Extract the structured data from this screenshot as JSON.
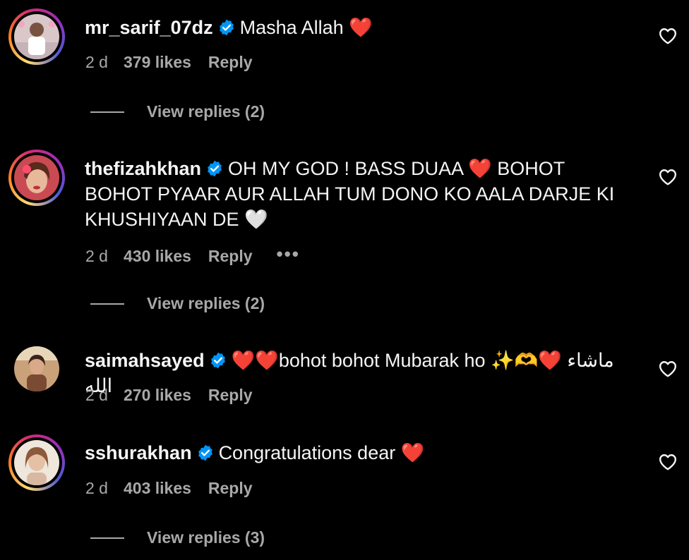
{
  "comments": [
    {
      "username": "mr_sarif_07dz",
      "text": "Masha Allah ❤️",
      "time": "2 d",
      "likes": "379 likes",
      "reply": "Reply",
      "view_replies": "View replies (2)"
    },
    {
      "username": "thefizahkhan",
      "text": "OH MY GOD ! BASS DUAA ❤️ BOHOT BOHOT PYAAR AUR ALLAH TUM DONO KO AALA DARJE KI KHUSHIYAAN DE 🤍",
      "time": "2 d",
      "likes": "430 likes",
      "reply": "Reply",
      "more": "•••",
      "view_replies": "View replies (2)"
    },
    {
      "username": "saimahsayed",
      "text": "❤️❤️bohot bohot Mubarak ho ✨🫶❤️ ماشاء الله",
      "time": "2 d",
      "likes": "270 likes",
      "reply": "Reply"
    },
    {
      "username": "sshurakhan",
      "text": "Congratulations dear ❤️",
      "time": "2 d",
      "likes": "403 likes",
      "reply": "Reply",
      "view_replies": "View replies (3)"
    }
  ],
  "icons": {
    "verified": "verified-badge-icon",
    "like": "heart-outline-icon"
  },
  "colors": {
    "background": "#000000",
    "text": "#f5f5f5",
    "secondary": "#a8a8a8",
    "verified": "#0095f6"
  }
}
